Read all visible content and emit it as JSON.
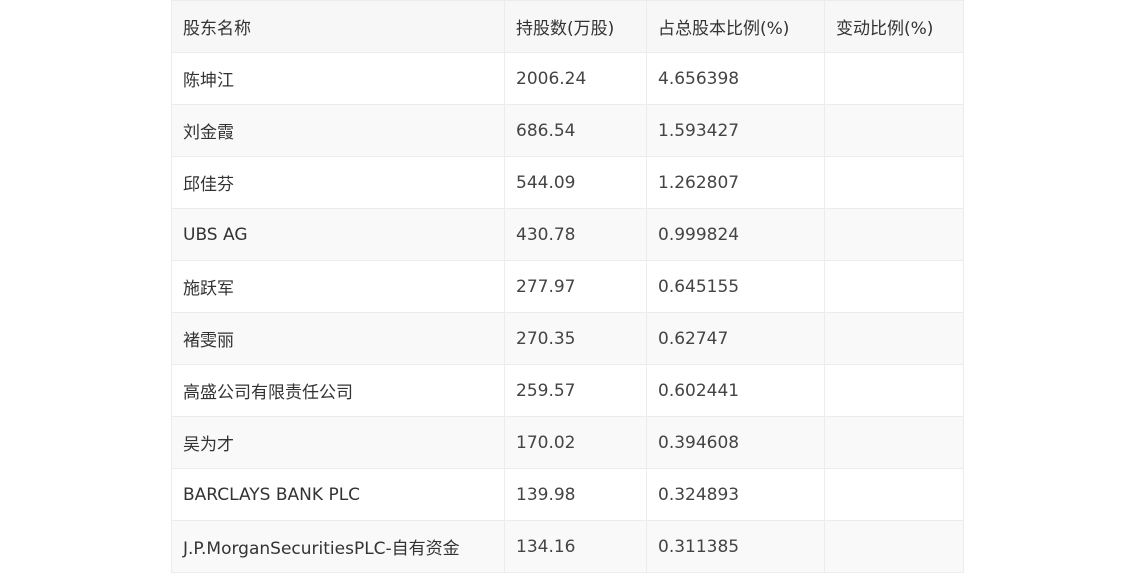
{
  "table": {
    "headers": [
      "股东名称",
      "持股数(万股)",
      "占总股本比例(%)",
      "变动比例(%)"
    ],
    "rows": [
      {
        "name": "陈坤江",
        "shares": "2006.24",
        "ratio": "4.656398",
        "change": ""
      },
      {
        "name": "刘金霞",
        "shares": "686.54",
        "ratio": "1.593427",
        "change": ""
      },
      {
        "name": "邱佳芬",
        "shares": "544.09",
        "ratio": "1.262807",
        "change": ""
      },
      {
        "name": "UBS AG",
        "shares": "430.78",
        "ratio": "0.999824",
        "change": ""
      },
      {
        "name": "施跃军",
        "shares": "277.97",
        "ratio": "0.645155",
        "change": ""
      },
      {
        "name": "褚雯丽",
        "shares": "270.35",
        "ratio": "0.62747",
        "change": ""
      },
      {
        "name": "高盛公司有限责任公司",
        "shares": "259.57",
        "ratio": "0.602441",
        "change": ""
      },
      {
        "name": "吴为才",
        "shares": "170.02",
        "ratio": "0.394608",
        "change": ""
      },
      {
        "name": "BARCLAYS BANK PLC",
        "shares": "139.98",
        "ratio": "0.324893",
        "change": ""
      },
      {
        "name": "J.P.MorganSecuritiesPLC-自有资金",
        "shares": "134.16",
        "ratio": "0.311385",
        "change": ""
      }
    ]
  }
}
